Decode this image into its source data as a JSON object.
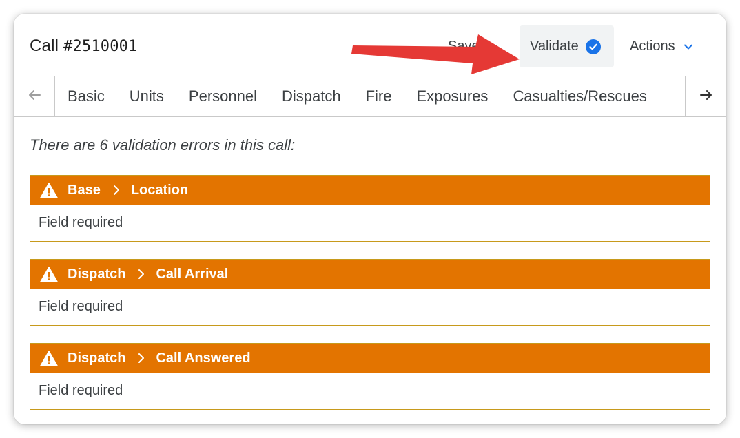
{
  "header": {
    "title_prefix": "Call ",
    "call_number": "#2510001",
    "save_label": "Save",
    "validate_label": "Validate",
    "actions_label": "Actions"
  },
  "tabs": [
    "Basic",
    "Units",
    "Personnel",
    "Dispatch",
    "Fire",
    "Exposures",
    "Casualties/Rescues"
  ],
  "summary": "There are 6 validation errors in this call:",
  "errors": [
    {
      "section": "Base",
      "field": "Location",
      "message": "Field required"
    },
    {
      "section": "Dispatch",
      "field": "Call Arrival",
      "message": "Field required"
    },
    {
      "section": "Dispatch",
      "field": "Call Answered",
      "message": "Field required"
    }
  ],
  "colors": {
    "error_header": "#e37400",
    "validate_check": "#1a73e8",
    "annotation_arrow": "#e53935"
  }
}
